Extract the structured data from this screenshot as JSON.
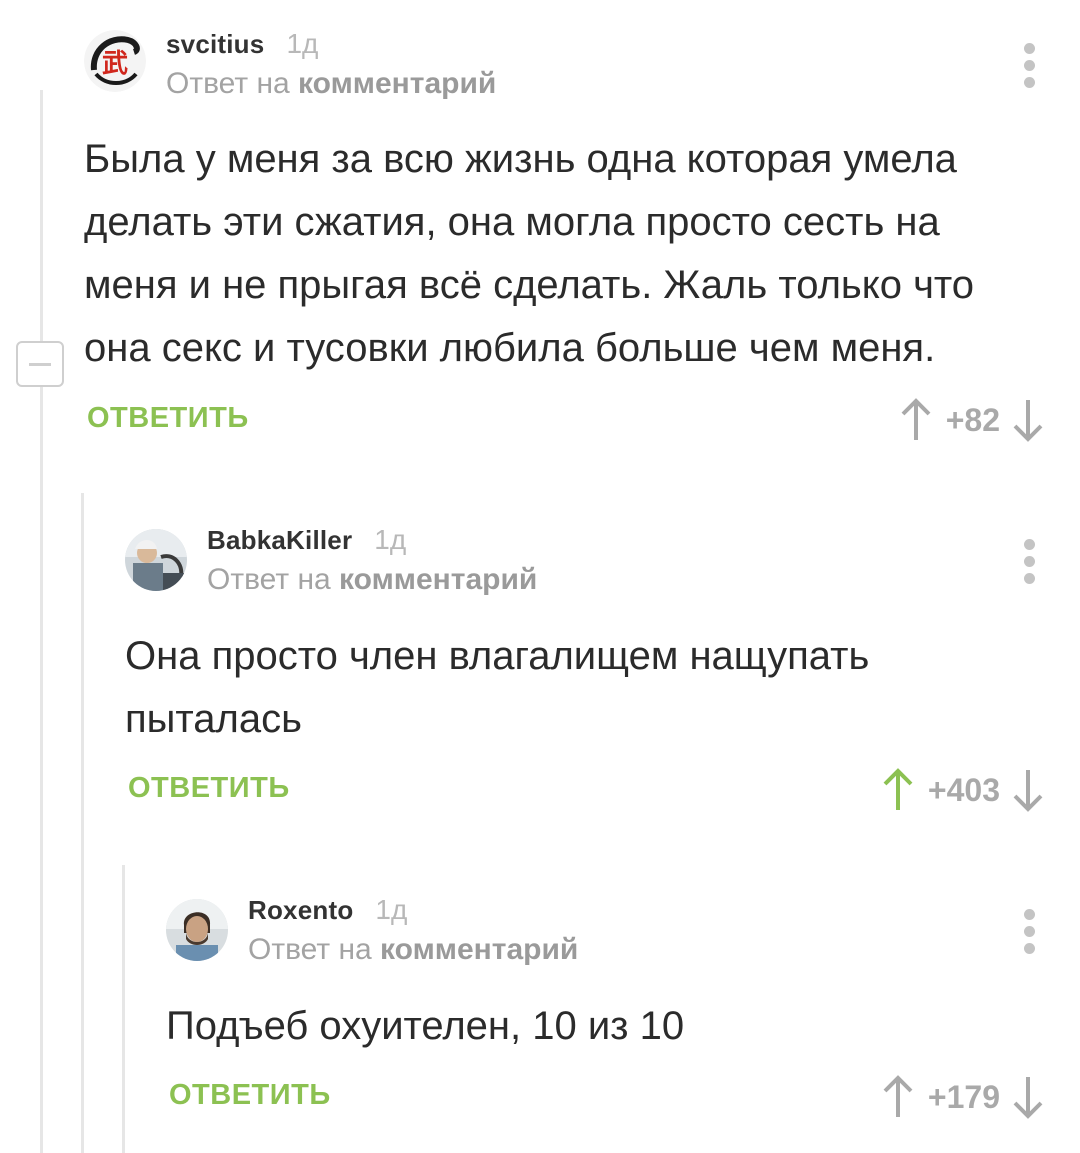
{
  "comments": [
    {
      "author": "svcitius",
      "time": "1д",
      "reply_prefix": "Ответ на",
      "reply_link": "комментарий",
      "text": "Была у меня за всю жизнь одна которая умела делать эти сжатия, она могла просто сесть на меня и не прыгая всё сделать. Жаль только что она секс и тусовки любила больше чем меня.",
      "reply_label": "ОТВЕТИТЬ",
      "rating": "+82",
      "upvoted": false
    },
    {
      "author": "BabkaKiller",
      "time": "1д",
      "reply_prefix": "Ответ на",
      "reply_link": "комментарий",
      "text": "Она просто член влагалищем нащупать пыталась",
      "reply_label": "ОТВЕТИТЬ",
      "rating": "+403",
      "upvoted": true
    },
    {
      "author": "Roxento",
      "time": "1д",
      "reply_prefix": "Ответ на",
      "reply_link": "комментарий",
      "text": "Подъеб охуителен, 10 из 10",
      "reply_label": "ОТВЕТИТЬ",
      "rating": "+179",
      "upvoted": false
    }
  ],
  "colors": {
    "accent_green": "#8cc152",
    "muted_gray": "#a9a9a9",
    "thread_line": "#e6e6e6"
  },
  "icons": [
    "kebab-menu-icon",
    "upvote-arrow-icon",
    "downvote-arrow-icon",
    "collapse-icon"
  ]
}
